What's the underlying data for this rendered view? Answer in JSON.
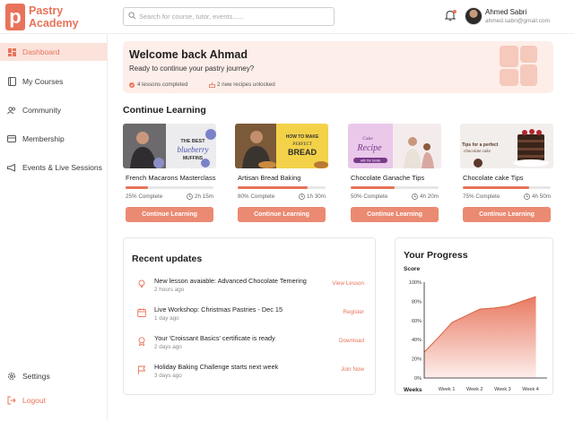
{
  "brand": {
    "line1": "Pastry",
    "line2": "Academy",
    "logo_letter": "p",
    "accent": "#e8735a"
  },
  "search": {
    "placeholder": "Search for course, tutor, events......",
    "value": ""
  },
  "user": {
    "name": "Ahmed Sabri",
    "email": "ahmed.sabri@gmail.com"
  },
  "sidebar": {
    "items": [
      {
        "label": "Dashboard",
        "icon": "dashboard-icon",
        "active": true
      },
      {
        "label": "My Courses",
        "icon": "book-icon"
      },
      {
        "label": "Community",
        "icon": "users-icon"
      },
      {
        "label": "Membership",
        "icon": "card-icon"
      },
      {
        "label": "Events & Live Sessions",
        "icon": "megaphone-icon"
      }
    ],
    "settings": "Settings",
    "logout": "Logout"
  },
  "welcome": {
    "title": "Welcome back Ahmad",
    "subtitle": "Ready to continue your pastry journey?",
    "stat1": "4 lessons completed",
    "stat2": "2 new recipes unlocked"
  },
  "continue": {
    "title": "Continue Learning",
    "courses": [
      {
        "title": "French Macarons Masterclass",
        "percent_label": "25% Complete",
        "progress": 0.25,
        "time": "2h 15m",
        "button": "Continue Learning",
        "img_text1": "THE BEST",
        "img_text2": "blueberry",
        "img_text3": "MUFFINS"
      },
      {
        "title": "Artisan Bread Baking",
        "percent_label": "80% Complete",
        "progress": 0.8,
        "time": "1h 30m",
        "button": "Continue Learning",
        "img_text1": "HOW TO MAKE",
        "img_text2": "PERFECT",
        "img_text3": "BREAD"
      },
      {
        "title": "Chocolate Ganache Tips",
        "percent_label": "50% Complete",
        "progress": 0.5,
        "time": "4h 20m",
        "button": "Continue Learning",
        "img_text1": "Cake",
        "img_text2": "Recipe",
        "img_text3": "with the family"
      },
      {
        "title": "Chocolate cake Tips",
        "percent_label": "75% Complete",
        "progress": 0.75,
        "time": "4h 50m",
        "button": "Continue Learning",
        "img_text1": "Tips for a perfect",
        "img_text2": "chocolate cake",
        "img_text3": ""
      }
    ]
  },
  "updates": {
    "title": "Recent updates",
    "items": [
      {
        "icon": "lightbulb-icon",
        "text": "New lesson avaiable: Advanced Chocolate Temering",
        "date": "2 hours ago",
        "action": "View Lesson"
      },
      {
        "icon": "calendar-icon",
        "text": "Live Workshop: Christmas Pastries - Dec 15",
        "date": "1 day ago",
        "action": "Register"
      },
      {
        "icon": "award-icon",
        "text": "Your 'Croissant Basics' certificate is ready",
        "date": "2 days ago",
        "action": "Download"
      },
      {
        "icon": "flag-icon",
        "text": "Holiday Baking Challenge starts next week",
        "date": "3 days ago",
        "action": "Join Now"
      }
    ]
  },
  "progress": {
    "title": "Your Progress",
    "ylabel": "Score",
    "xlabel": "Weeks"
  },
  "chart_data": {
    "type": "area",
    "title": "Your Progress",
    "xlabel": "Weeks",
    "ylabel": "Score",
    "x": [
      0,
      0.5,
      1,
      1.5,
      2,
      2.5,
      3,
      3.5,
      4
    ],
    "y": [
      27,
      42,
      58,
      65,
      72,
      73,
      75,
      80,
      85
    ],
    "xticks": [
      "Week 1",
      "Week 2",
      "Week 3",
      "Week 4"
    ],
    "xtick_values": [
      1,
      2,
      3,
      4
    ],
    "yticks": [
      "0%",
      "20%",
      "40%",
      "60%",
      "80%",
      "100%"
    ],
    "ytick_values": [
      0,
      20,
      40,
      60,
      80,
      100
    ],
    "xlim": [
      0,
      4.4
    ],
    "ylim": [
      0,
      100
    ],
    "color": "#e8735a",
    "grid": false
  }
}
